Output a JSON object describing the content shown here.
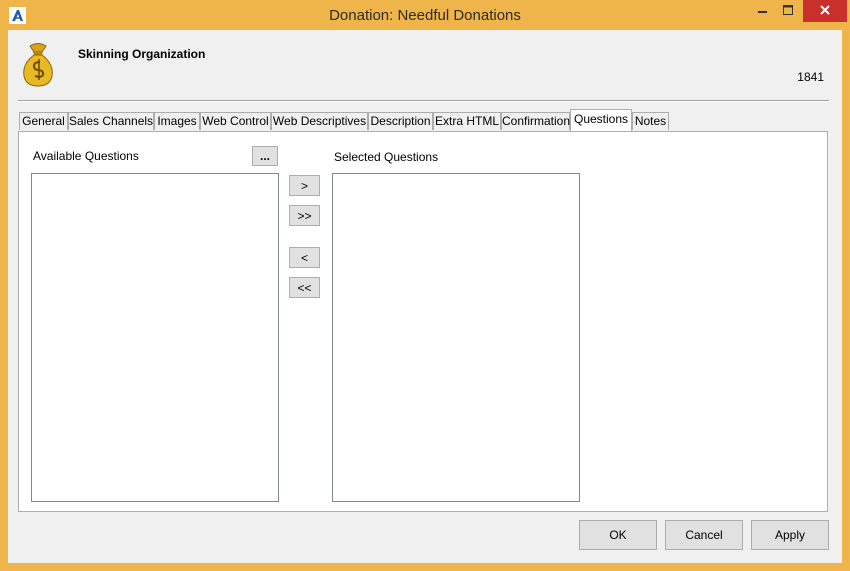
{
  "window": {
    "title": "Donation: Needful Donations"
  },
  "header": {
    "organization": "Skinning Organization",
    "record_id": "1841"
  },
  "tabs": [
    {
      "label": "General"
    },
    {
      "label": "Sales Channels"
    },
    {
      "label": "Images"
    },
    {
      "label": "Web Control"
    },
    {
      "label": "Web Descriptives"
    },
    {
      "label": "Description"
    },
    {
      "label": "Extra HTML"
    },
    {
      "label": "Confirmation"
    },
    {
      "label": "Questions",
      "active": true
    },
    {
      "label": "Notes"
    }
  ],
  "questions": {
    "available_label": "Available Questions",
    "selected_label": "Selected Questions",
    "browse_label": "...",
    "add_label": ">",
    "add_all_label": ">>",
    "remove_label": "<",
    "remove_all_label": "<<",
    "available_items": [],
    "selected_items": []
  },
  "footer": {
    "ok_label": "OK",
    "cancel_label": "Cancel",
    "apply_label": "Apply"
  },
  "colors": {
    "title_bar": "#f0b54a",
    "close_button": "#c9302c",
    "panel": "#f0f0f0"
  }
}
